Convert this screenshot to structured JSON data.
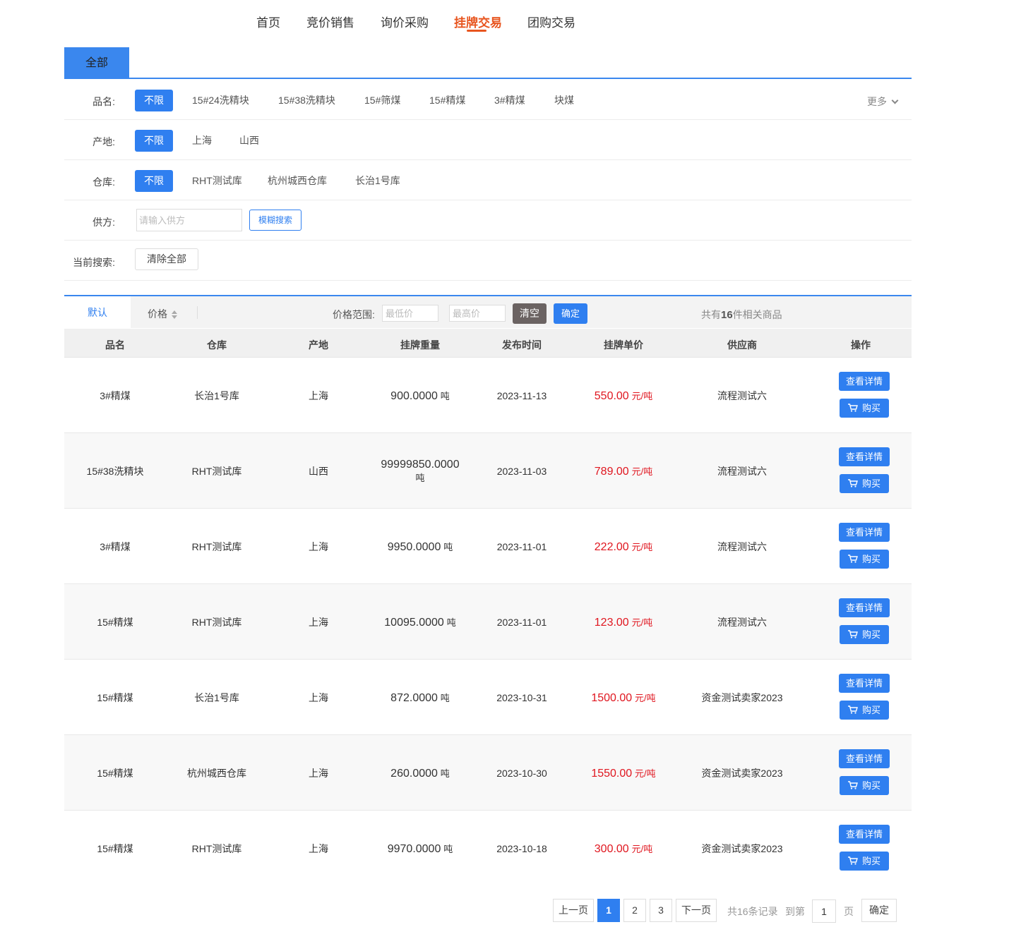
{
  "nav": {
    "items": [
      "首页",
      "竞价销售",
      "询价采购",
      "挂牌交易",
      "团购交易"
    ],
    "active_index": 3,
    "accent_color": "#e8551f"
  },
  "category_tab": {
    "label": "全部"
  },
  "filters": {
    "product": {
      "label": "品名:",
      "selected": "不限",
      "options": [
        "15#24洗精块",
        "15#38洗精块",
        "15#筛煤",
        "15#精煤",
        "3#精煤",
        "块煤"
      ],
      "more": "更多"
    },
    "origin": {
      "label": "产地:",
      "selected": "不限",
      "options": [
        "上海",
        "山西"
      ]
    },
    "warehouse": {
      "label": "仓库:",
      "selected": "不限",
      "options": [
        "RHT测试库",
        "杭州城西仓库",
        "长治1号库"
      ]
    },
    "supplier": {
      "label": "供方:",
      "placeholder": "请输入供方",
      "button": "模糊搜索"
    },
    "current": {
      "label": "当前搜索:",
      "button": "清除全部"
    }
  },
  "sortbar": {
    "default": "默认",
    "price": "价格",
    "range_label": "价格范围:",
    "min_placeholder": "最低价",
    "max_placeholder": "最高价",
    "clear": "清空",
    "confirm": "确定",
    "total_prefix": "共有",
    "total_count": "16",
    "total_suffix": "件相关商品"
  },
  "table": {
    "headers": [
      "品名",
      "仓库",
      "产地",
      "挂牌重量",
      "发布时间",
      "挂牌单价",
      "供应商",
      "操作"
    ],
    "detail_label": "查看详情",
    "buy_label": "购买",
    "rows": [
      {
        "name": "3#精煤",
        "warehouse": "长治1号库",
        "origin": "上海",
        "weight": "900.0000",
        "weight_unit": "吨",
        "date": "2023-11-13",
        "price": "550.00",
        "price_unit": "元/吨",
        "supplier": "流程测试六"
      },
      {
        "name": "15#38洗精块",
        "warehouse": "RHT测试库",
        "origin": "山西",
        "weight": "99999850.0000",
        "weight_unit": "吨",
        "date": "2023-11-03",
        "price": "789.00",
        "price_unit": "元/吨",
        "supplier": "流程测试六"
      },
      {
        "name": "3#精煤",
        "warehouse": "RHT测试库",
        "origin": "上海",
        "weight": "9950.0000",
        "weight_unit": "吨",
        "date": "2023-11-01",
        "price": "222.00",
        "price_unit": "元/吨",
        "supplier": "流程测试六"
      },
      {
        "name": "15#精煤",
        "warehouse": "RHT测试库",
        "origin": "上海",
        "weight": "10095.0000",
        "weight_unit": "吨",
        "date": "2023-11-01",
        "price": "123.00",
        "price_unit": "元/吨",
        "supplier": "流程测试六"
      },
      {
        "name": "15#精煤",
        "warehouse": "长治1号库",
        "origin": "上海",
        "weight": "872.0000",
        "weight_unit": "吨",
        "date": "2023-10-31",
        "price": "1500.00",
        "price_unit": "元/吨",
        "supplier": "资金测试卖家2023"
      },
      {
        "name": "15#精煤",
        "warehouse": "杭州城西仓库",
        "origin": "上海",
        "weight": "260.0000",
        "weight_unit": "吨",
        "date": "2023-10-30",
        "price": "1550.00",
        "price_unit": "元/吨",
        "supplier": "资金测试卖家2023"
      },
      {
        "name": "15#精煤",
        "warehouse": "RHT测试库",
        "origin": "上海",
        "weight": "9970.0000",
        "weight_unit": "吨",
        "date": "2023-10-18",
        "price": "300.00",
        "price_unit": "元/吨",
        "supplier": "资金测试卖家2023"
      }
    ]
  },
  "pagination": {
    "prev": "上一页",
    "pages": [
      "1",
      "2",
      "3"
    ],
    "current": "1",
    "next": "下一页",
    "total_records": "共16条记录",
    "goto_prefix": "到第",
    "goto_value": "1",
    "goto_suffix": "页",
    "goto_button": "确定"
  },
  "colors": {
    "primary": "#2f7ff0",
    "price": "#e0161f",
    "clear_button": "#6b6362"
  }
}
